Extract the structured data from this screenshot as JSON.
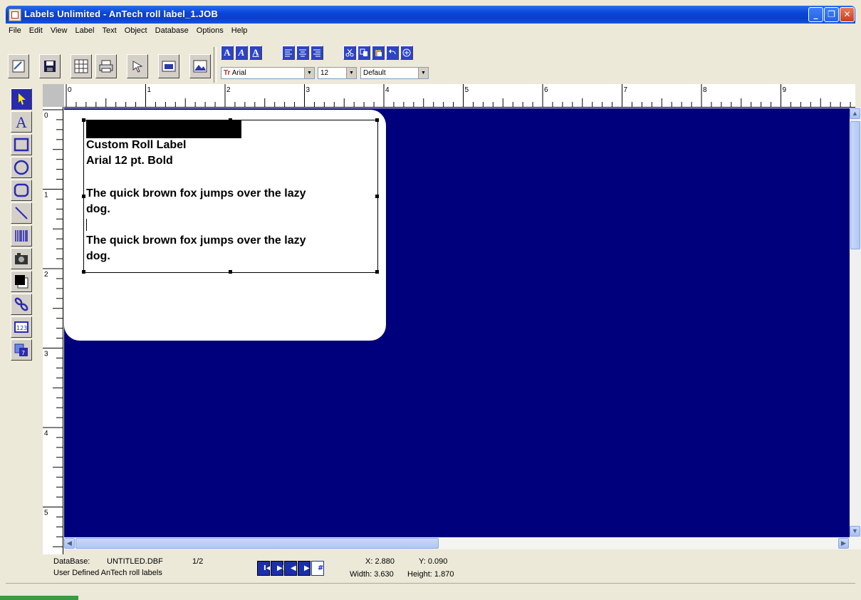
{
  "window": {
    "title": "Labels Unlimited - AnTech roll label_1.JOB"
  },
  "menu": [
    "File",
    "Edit",
    "View",
    "Label",
    "Text",
    "Object",
    "Database",
    "Options",
    "Help"
  ],
  "toolbar": {
    "font_name": "Arial",
    "font_size": "12",
    "style_value": "Default",
    "text_buttons": [
      "A",
      "A",
      "A"
    ]
  },
  "rulers": {
    "h_ticks": [
      "0",
      "1",
      "2",
      "3",
      "4",
      "5",
      "6",
      "7",
      "8",
      "9"
    ],
    "v_ticks": [
      "0",
      "1",
      "2",
      "3",
      "4",
      "5"
    ]
  },
  "label": {
    "line1": "Custom Roll Label",
    "line2": "Arial 12 pt. Bold",
    "para1a": "The quick brown fox jumps over the lazy",
    "para1b": "dog.",
    "para2a": "The quick brown fox jumps over the lazy",
    "para2b": "dog."
  },
  "status": {
    "db_label": "DataBase:",
    "db_name": "UNTITLED.DBF",
    "record": "1/2",
    "label_type": "User Defined AnTech roll labels",
    "x": "X: 2.880",
    "y": "Y: 0.090",
    "width": "Width: 3.630",
    "height": "Height: 1.870"
  }
}
